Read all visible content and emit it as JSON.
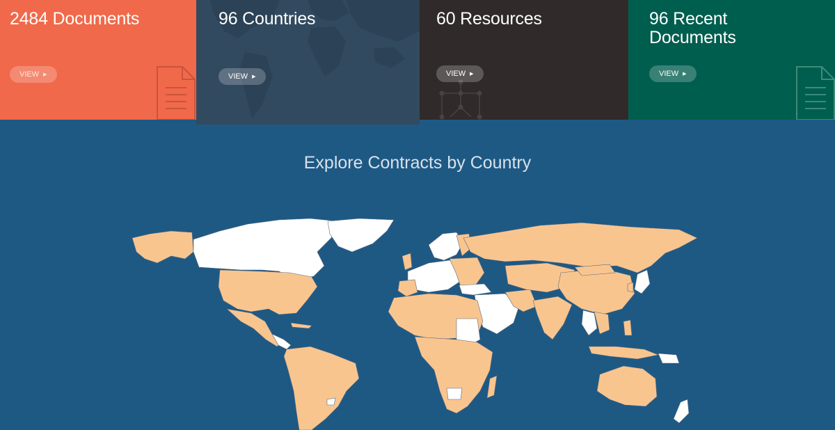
{
  "stats": [
    {
      "title": "2484 Documents",
      "button": "VIEW"
    },
    {
      "title": "96 Countries",
      "button": "VIEW"
    },
    {
      "title": "60 Resources",
      "button": "VIEW"
    },
    {
      "title": "96 Recent Documents",
      "button": "VIEW"
    }
  ],
  "map": {
    "heading": "Explore Contracts by Country",
    "land_color": "#f9c58f",
    "other_color": "#ffffff",
    "ocean_color": "#1e5984"
  },
  "colors": {
    "documents": "#f0694a",
    "countries": "#324a5f",
    "resources": "#302a2a",
    "recent": "#005e4e"
  }
}
